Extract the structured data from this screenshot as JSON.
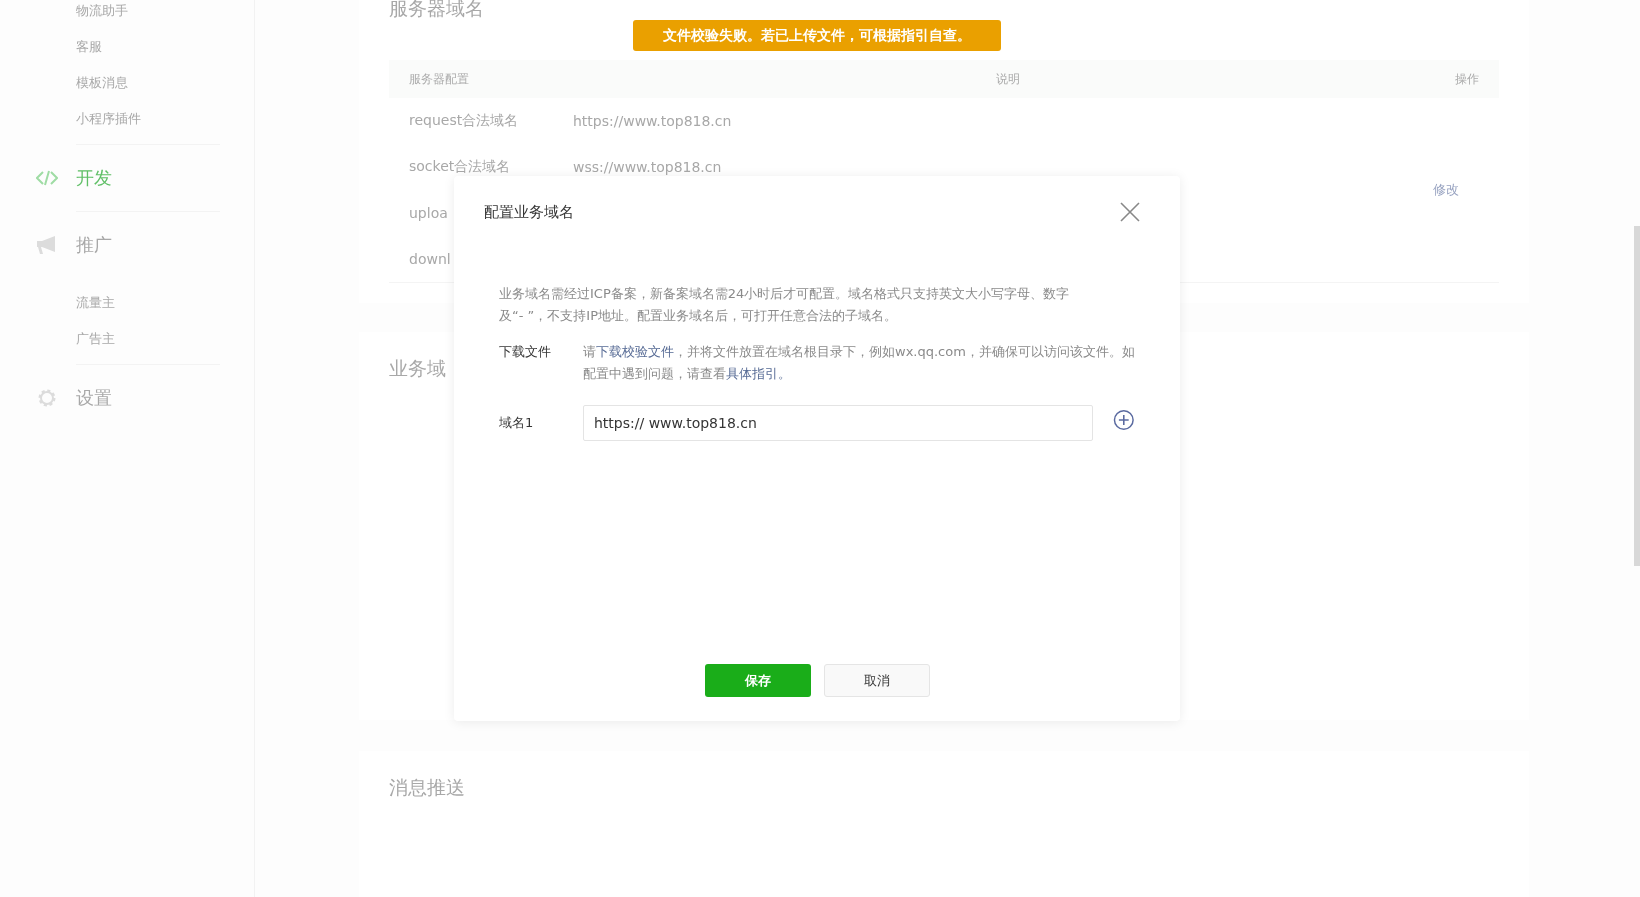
{
  "sidebar": {
    "items": [
      {
        "kind": "sub",
        "label": "物流助手",
        "selected": false
      },
      {
        "kind": "sub",
        "label": "客服",
        "selected": false
      },
      {
        "kind": "sub",
        "label": "模板消息",
        "selected": false
      },
      {
        "kind": "sub",
        "label": "小程序插件",
        "selected": false
      },
      {
        "kind": "section",
        "label": "开发",
        "selected": true
      },
      {
        "kind": "section",
        "label": "推广",
        "selected": false
      },
      {
        "kind": "sub",
        "label": "流量主",
        "selected": false
      },
      {
        "kind": "sub",
        "label": "广告主",
        "selected": false
      },
      {
        "kind": "section",
        "label": "设置",
        "selected": false
      }
    ]
  },
  "server_domains": {
    "title": "服务器域名",
    "table": {
      "columns": [
        "服务器配置",
        "说明",
        "操作"
      ],
      "rows": [
        {
          "name": "request合法域名",
          "value": "https://www.top818.cn"
        },
        {
          "name": "socket合法域名",
          "value": "wss://www.top818.cn"
        },
        {
          "name": "uploa"
        },
        {
          "name": "downl"
        }
      ],
      "action": "修改"
    }
  },
  "business_domains": {
    "title": "业务域"
  },
  "message_push": {
    "title": "消息推送"
  },
  "toast": "文件校验失败。若已上传文件，可根据指引自查。",
  "dialog": {
    "title": "配置业务域名",
    "description": "业务域名需经过ICP备案，新备案域名需24小时后才可配置。域名格式只支持英文大小写字母、数字及“- ”，不支持IP地址。配置业务域名后，可打开任意合法的子域名。",
    "download": {
      "label": "下载文件",
      "parts": [
        {
          "text": "请"
        },
        {
          "text": "下载校验文件",
          "link": true
        },
        {
          "text": "，并将文件放置在域名根目录下，例如wx.qq.com，并确保可以访问该文件。如配置中遇到问题，请查看"
        },
        {
          "text": "具体指引。",
          "link": true
        }
      ]
    },
    "field": {
      "label": "域名1",
      "value": "https:// www.top818.cn"
    },
    "buttons": [
      {
        "label": "保存",
        "kind": "primary"
      },
      {
        "label": "取消",
        "kind": "default"
      }
    ]
  }
}
